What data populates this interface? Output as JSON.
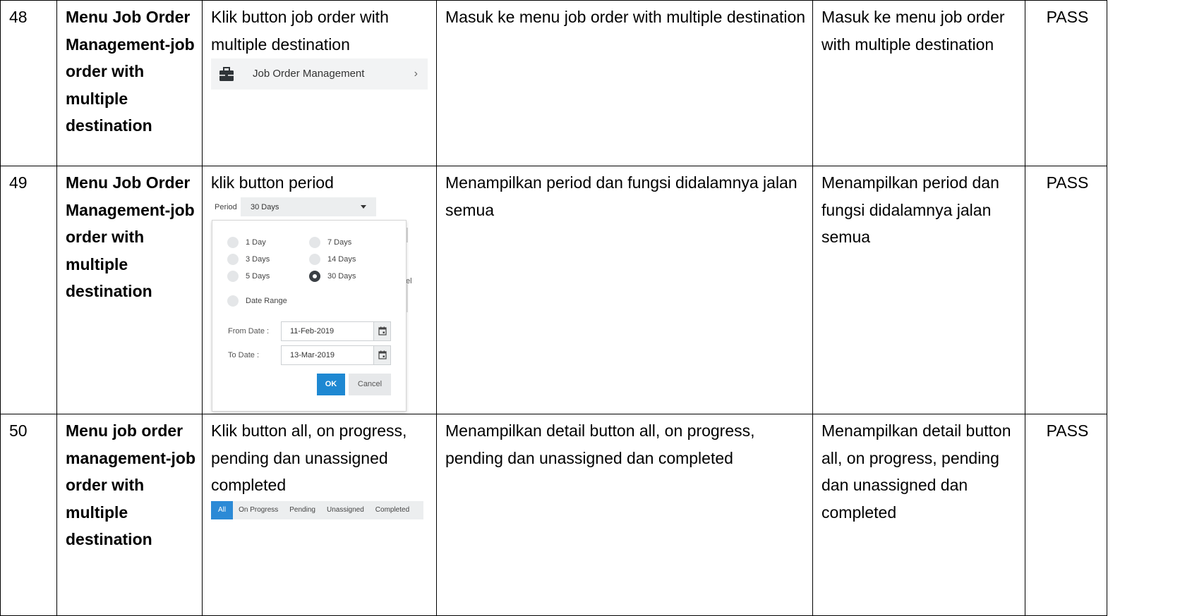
{
  "rows": [
    {
      "no": "48",
      "title": "Menu Job Order Management-job order with multiple destination",
      "steps": "Klik button job order with multiple destination",
      "expected": "Masuk ke menu job order with multiple destination",
      "actual": "Masuk ke menu job order with multiple destination",
      "status": "PASS"
    },
    {
      "no": "49",
      "title": "Menu Job Order Management-job order with multiple destination",
      "steps": "klik button period",
      "expected": "Menampilkan period dan fungsi didalamnya jalan semua",
      "actual": "Menampilkan period dan fungsi didalamnya jalan semua",
      "status": "PASS"
    },
    {
      "no": "50",
      "title": "Menu job order management-job order with multiple destination",
      "steps": "Klik button all, on progress, pending dan unassigned completed",
      "expected": "Menampilkan detail button all, on progress, pending dan unassigned dan completed",
      "actual": "Menampilkan detail button all, on progress, pending dan unassigned dan completed",
      "status": "PASS"
    }
  ],
  "menu_shot": {
    "icon": "briefcase-icon",
    "label": "Job Order Management",
    "chevron": "›"
  },
  "period_shot": {
    "label": "Period",
    "selected": "30 Days",
    "options": [
      "1 Day",
      "7 Days",
      "3 Days",
      "14 Days",
      "5 Days",
      "30 Days",
      "Date Range"
    ],
    "checked_option": "30 Days",
    "from_label": "From Date :",
    "from_value": "11-Feb-2019",
    "to_label": "To Date :",
    "to_value": "13-Mar-2019",
    "ok_label": "OK",
    "cancel_label": "Cancel",
    "behind_fragment": "el",
    "accent_color": "#1e88d2"
  },
  "tabs_shot": {
    "tabs": [
      "All",
      "On Progress",
      "Pending",
      "Unassigned",
      "Completed"
    ],
    "active_tab": "All",
    "accent_color": "#2c8ad6"
  }
}
